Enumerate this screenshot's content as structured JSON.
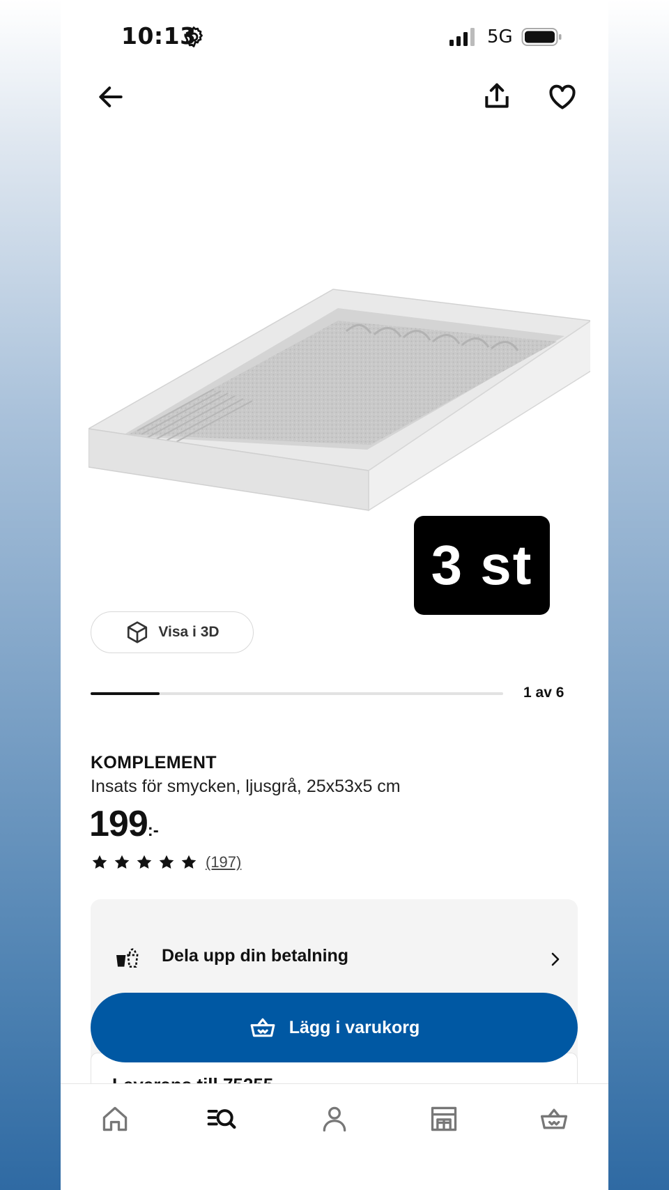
{
  "status_bar": {
    "time": "10:13",
    "network": "5G",
    "icons": [
      "settings-gear-icon",
      "signal-icon",
      "battery-icon"
    ]
  },
  "top_nav": {
    "icons": [
      "back-arrow-icon",
      "share-icon",
      "heart-icon"
    ]
  },
  "product_image": {
    "quantity_badge": "3 st"
  },
  "view_3d": {
    "label": "Visa i 3D",
    "icon": "cube-icon"
  },
  "gallery": {
    "pager": "1 av 6",
    "progress": 0.1667
  },
  "product": {
    "brand": "KOMPLEMENT",
    "description": "Insats för smycken, ljusgrå, 25x53x5 cm",
    "price": "199",
    "price_suffix": ":-",
    "rating_stars": 5,
    "review_count": "(197)"
  },
  "payment": {
    "label": "Dela upp din betalning",
    "icon": "split-payment-icon"
  },
  "cart_button": {
    "label": "Lägg i varukorg",
    "icon": "basket-icon"
  },
  "peek_section": {
    "text": "Leverans till 75255"
  },
  "tab_bar": {
    "tabs": [
      "home-icon",
      "search-icon",
      "profile-icon",
      "store-icon",
      "basket-icon"
    ]
  },
  "colors": {
    "primary": "#0058a3",
    "text": "#111111",
    "card_bg": "#f4f4f4",
    "badge_bg": "#000000"
  }
}
